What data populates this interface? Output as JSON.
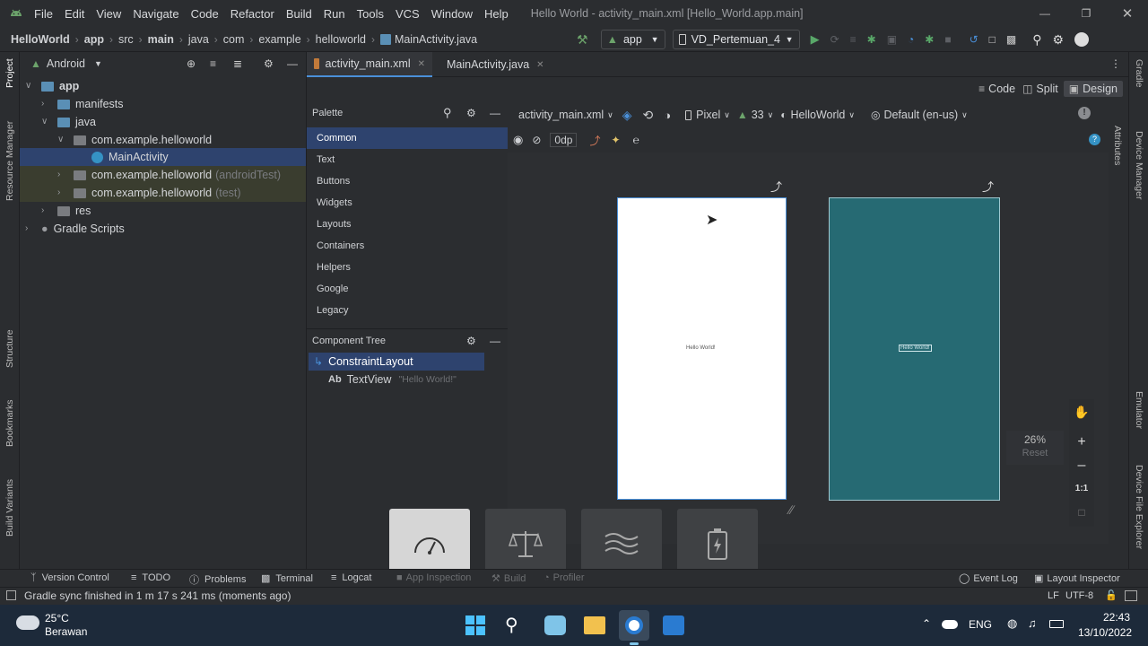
{
  "window": {
    "menu": [
      "File",
      "Edit",
      "View",
      "Navigate",
      "Code",
      "Refactor",
      "Build",
      "Run",
      "Tools",
      "VCS",
      "Window",
      "Help"
    ],
    "title": "Hello World - activity_main.xml [Hello_World.app.main]"
  },
  "breadcrumb": [
    "HelloWorld",
    "app",
    "src",
    "main",
    "java",
    "com",
    "example",
    "helloworld",
    "MainActivity.java"
  ],
  "toolbar": {
    "run_config": "app",
    "device": "VD_Pertemuan_4"
  },
  "project_panel": {
    "view_selector": "Android",
    "items": [
      {
        "label": "app",
        "muted": ""
      },
      {
        "label": "manifests",
        "muted": ""
      },
      {
        "label": "java",
        "muted": ""
      },
      {
        "label": "com.example.helloworld",
        "muted": ""
      },
      {
        "label": "MainActivity",
        "muted": ""
      },
      {
        "label": "com.example.helloworld",
        "muted": "(androidTest)"
      },
      {
        "label": "com.example.helloworld",
        "muted": "(test)"
      },
      {
        "label": "res",
        "muted": ""
      },
      {
        "label": "Gradle Scripts",
        "muted": ""
      }
    ]
  },
  "left_strip": [
    "Project",
    "Resource Manager",
    "Structure",
    "Bookmarks",
    "Build Variants"
  ],
  "right_strip": [
    "Gradle",
    "Device Manager",
    "Emulator",
    "Device File Explorer"
  ],
  "editor": {
    "tabs": [
      "activity_main.xml",
      "MainActivity.java"
    ],
    "modes": [
      "Code",
      "Split",
      "Design"
    ]
  },
  "palette": {
    "title": "Palette",
    "categories": [
      "Common",
      "Text",
      "Buttons",
      "Widgets",
      "Layouts",
      "Containers",
      "Helpers",
      "Google",
      "Legacy"
    ]
  },
  "component_tree": {
    "title": "Component Tree",
    "root": "ConstraintLayout",
    "child_prefix": "Ab",
    "child": "TextView",
    "child_text": "\"Hello World!\""
  },
  "design_toolbar": {
    "file": "activity_main.xml",
    "device": "Pixel",
    "api": "33",
    "theme": "HelloWorld",
    "locale": "Default (en-us)",
    "margin": "0dp",
    "attributes_label": "Attributes"
  },
  "canvas": {
    "preview_text": "Hello World!",
    "blueprint_text": "Hello World!",
    "zoom": "26%",
    "reset": "Reset",
    "one_to_one": "1:1"
  },
  "bottom_tools": {
    "left": [
      "Version Control",
      "TODO",
      "Problems",
      "Terminal",
      "Logcat",
      "App Inspection",
      "Build",
      "Profiler"
    ],
    "right": [
      "Event Log",
      "Layout Inspector"
    ]
  },
  "status": {
    "message": "Gradle sync finished in 1 m 17 s 241 ms (moments ago)",
    "line_sep": "LF",
    "encoding": "UTF-8"
  },
  "taskbar": {
    "temp": "25°C",
    "weather": "Berawan",
    "lang": "ENG",
    "time": "22:43",
    "date": "13/10/2022"
  },
  "colors": {
    "accent": "#4a90d9",
    "selected_bg": "#2e436e",
    "blueprint": "#266a73",
    "android_green": "#6ca36b"
  }
}
